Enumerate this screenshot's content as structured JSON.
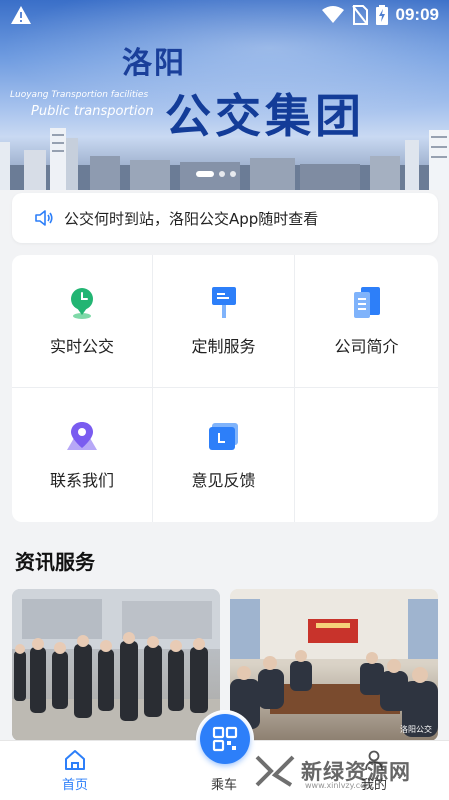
{
  "status_bar": {
    "time": "09:09",
    "icons": [
      "warning-icon",
      "wifi-icon",
      "no-sim-icon",
      "battery-charging-icon"
    ]
  },
  "banner": {
    "title_line1": "洛阳",
    "title_line2": "公交集团",
    "subtitle_en1": "Luoyang Transportion facilities",
    "subtitle_en2": "Public transportion",
    "active_slide": 1,
    "slide_count": 3
  },
  "notice": {
    "icon": "speaker-icon",
    "text": "公交何时到站，洛阳公交App随时查看"
  },
  "services": [
    {
      "label": "实时公交",
      "icon": "bus-clock-pin-icon",
      "color": "#22b573"
    },
    {
      "label": "定制服务",
      "icon": "bus-stop-sign-icon",
      "color": "#2d7ff9"
    },
    {
      "label": "公司简介",
      "icon": "document-icon",
      "color": "#2d7ff9"
    },
    {
      "label": "联系我们",
      "icon": "location-pin-icon",
      "color": "#7a5cf0"
    },
    {
      "label": "意见反馈",
      "icon": "feedback-card-icon",
      "color": "#2d7ff9"
    }
  ],
  "section": {
    "title": "资讯服务"
  },
  "news": [
    {
      "image": "officials-inspection-photo"
    },
    {
      "image": "meeting-room-photo",
      "tag": "洛阳公交"
    }
  ],
  "tabbar": {
    "home_label": "首页",
    "ride_label": "乘车",
    "me_label": "我的"
  },
  "watermark": {
    "text": "新绿资源网",
    "sub": "www.xinlvzy.com"
  },
  "colors": {
    "accent": "#2d7ff9",
    "banner_title": "#133c98",
    "background": "#f2f3f5"
  }
}
